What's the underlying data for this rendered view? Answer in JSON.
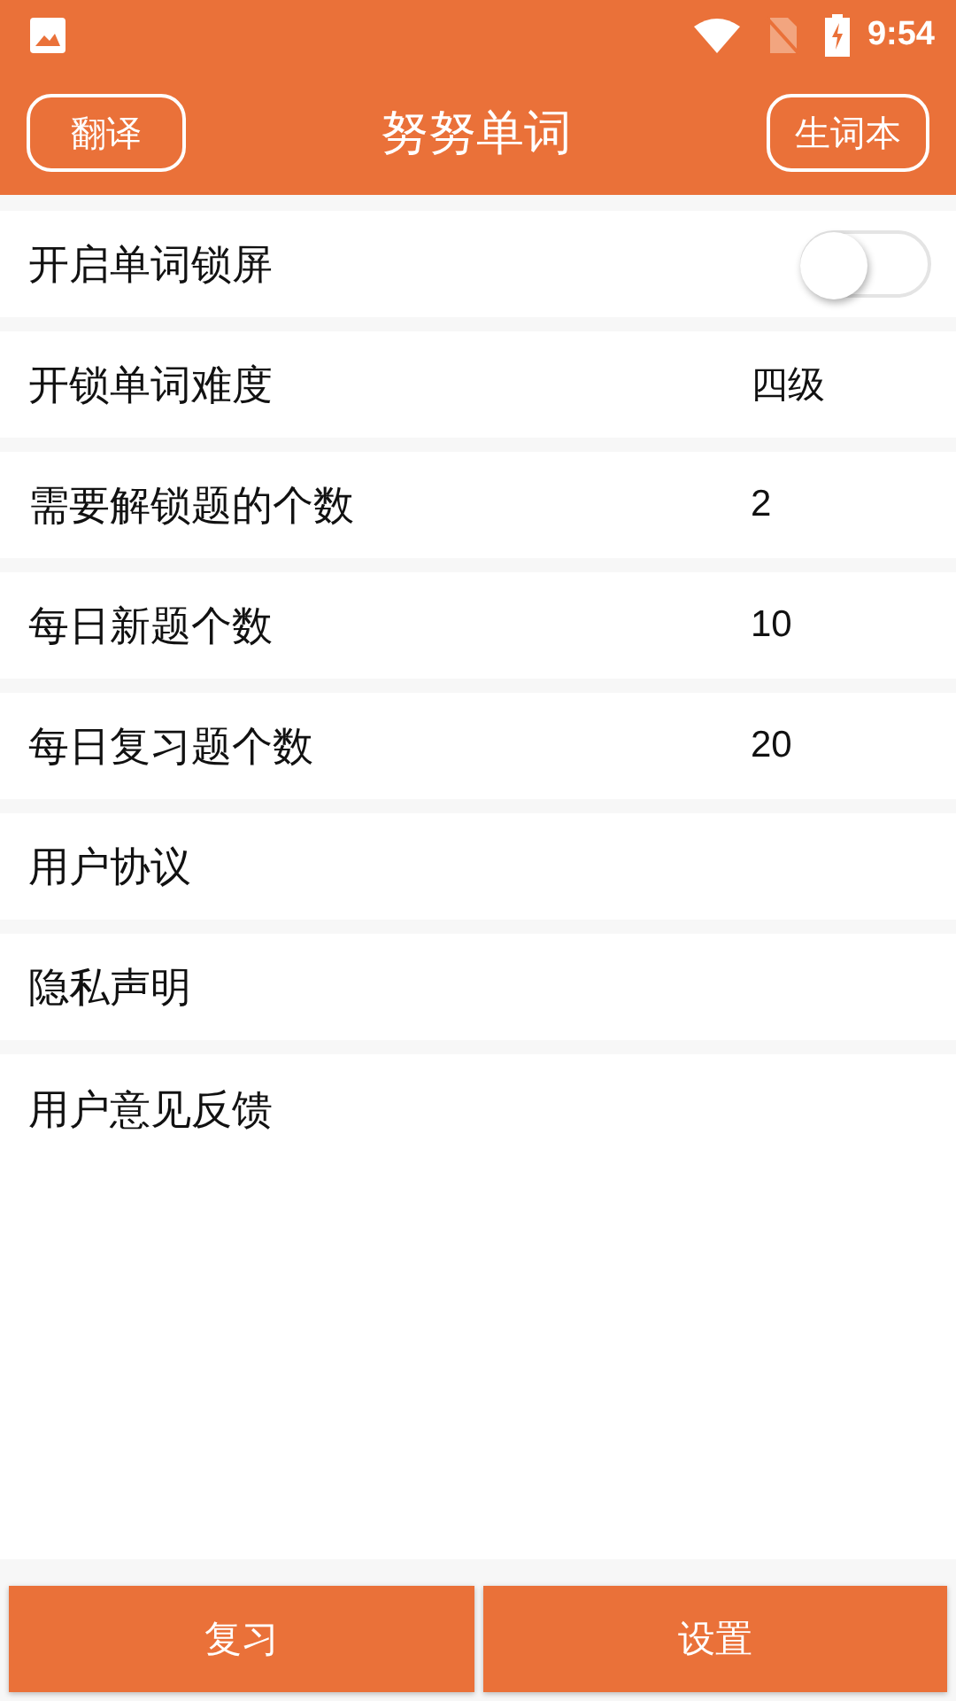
{
  "status_bar": {
    "time": "9:54"
  },
  "header": {
    "left_button": "翻译",
    "title": "努努单词",
    "right_button": "生词本"
  },
  "settings": [
    {
      "kind": "toggle",
      "label": "开启单词锁屏",
      "on": false
    },
    {
      "kind": "value",
      "label": "开锁单词难度",
      "value": "四级"
    },
    {
      "kind": "value",
      "label": "需要解锁题的个数",
      "value": "2"
    },
    {
      "kind": "value",
      "label": "每日新题个数",
      "value": "10"
    },
    {
      "kind": "value",
      "label": "每日复习题个数",
      "value": "20"
    },
    {
      "kind": "link",
      "label": "用户协议"
    },
    {
      "kind": "link",
      "label": "隐私声明"
    },
    {
      "kind": "link",
      "label": "用户意见反馈"
    }
  ],
  "bottom_buttons": [
    "复习",
    "设置"
  ]
}
